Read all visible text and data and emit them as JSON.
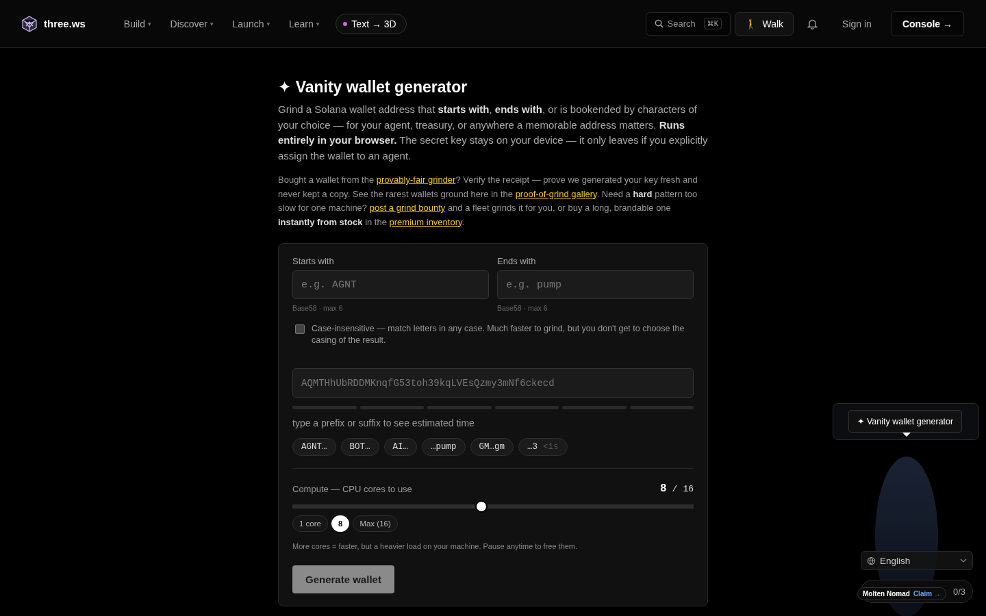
{
  "nav": {
    "brand": "three.ws",
    "menu": [
      {
        "label": "Build",
        "caret": "▾"
      },
      {
        "label": "Discover",
        "caret": "▾"
      },
      {
        "label": "Launch",
        "caret": "▾"
      },
      {
        "label": "Learn",
        "caret": "▾"
      }
    ],
    "feature": "Text → 3D",
    "search": {
      "label": "Search",
      "shortcut": "⌘K"
    },
    "walk": {
      "emoji": "🚶",
      "label": "Walk"
    },
    "sign_in": "Sign in",
    "console": "Console →"
  },
  "header": {
    "title": "✦ Vanity wallet generator",
    "intro": "Grind a Solana wallet address that **starts with**, **ends with**, or is bookended by characters of your choice — for your agent, treasury, or anywhere a memorable address matters. **Runs entirely in your browser.** The secret key stays on your device — it only leaves if you explicitly assign the wallet to an agent.",
    "links_paragraph": [
      {
        "kind": "text",
        "text": "Bought a wallet from the "
      },
      {
        "kind": "link",
        "text": "provably-fair grinder"
      },
      {
        "kind": "text",
        "text": "? Verify the receipt — prove we generated your key fresh and never kept a copy. See the rarest wallets ground here in the "
      },
      {
        "kind": "link",
        "text": "proof-of-grind gallery"
      },
      {
        "kind": "text",
        "text": ". Need a **hard** pattern too slow for one machine? "
      },
      {
        "kind": "link",
        "text": "post a grind bounty"
      },
      {
        "kind": "text",
        "text": " and a fleet grinds it for you, or buy a long, brandable one **instantly from stock** in the "
      },
      {
        "kind": "link",
        "text": "premium inventory"
      },
      {
        "kind": "text",
        "text": "."
      }
    ]
  },
  "form": {
    "fields": [
      {
        "label": "Starts with",
        "placeholder": "e.g. AGNT",
        "hint": "Base58 · max 6"
      },
      {
        "label": "Ends with",
        "placeholder": "e.g. pump",
        "hint": "Base58 · max 6"
      }
    ],
    "case_insensitive": {
      "checked": false,
      "label": "Case-insensitive — match letters in any case. Much faster to grind, but you don't get to choose the casing of the result."
    },
    "preview": {
      "placeholder": "AQMTHhUbRDDMKnqfG53toh39kqLVEsQzmy3mNf6ckecd"
    },
    "estimate": "type a prefix or suffix to see estimated time",
    "examples": [
      {
        "label": "AGNT…"
      },
      {
        "label": "BOT…"
      },
      {
        "label": "AI…"
      },
      {
        "label": "…pump"
      },
      {
        "label": "GM…gm"
      },
      {
        "label": "…3",
        "time": "<1s"
      }
    ],
    "compute": {
      "label": "Compute — CPU cores to use",
      "value": "8",
      "separator": "/",
      "total": "16",
      "level": 0.47,
      "presets": [
        {
          "label": "1 core",
          "selected": false
        },
        {
          "label": "8",
          "selected": true
        },
        {
          "label": "Max (16)",
          "selected": false
        }
      ],
      "note": "More cores = faster, but a heavier load on your machine. Pause anytime to free them."
    },
    "generate": {
      "label": "Generate wallet",
      "disabled": true
    }
  },
  "widget": {
    "tooltip": "✦ Vanity wallet generator",
    "language": "English",
    "progress": "0/3",
    "badge": {
      "name": "Molten Nomad",
      "action": "Claim →"
    }
  }
}
